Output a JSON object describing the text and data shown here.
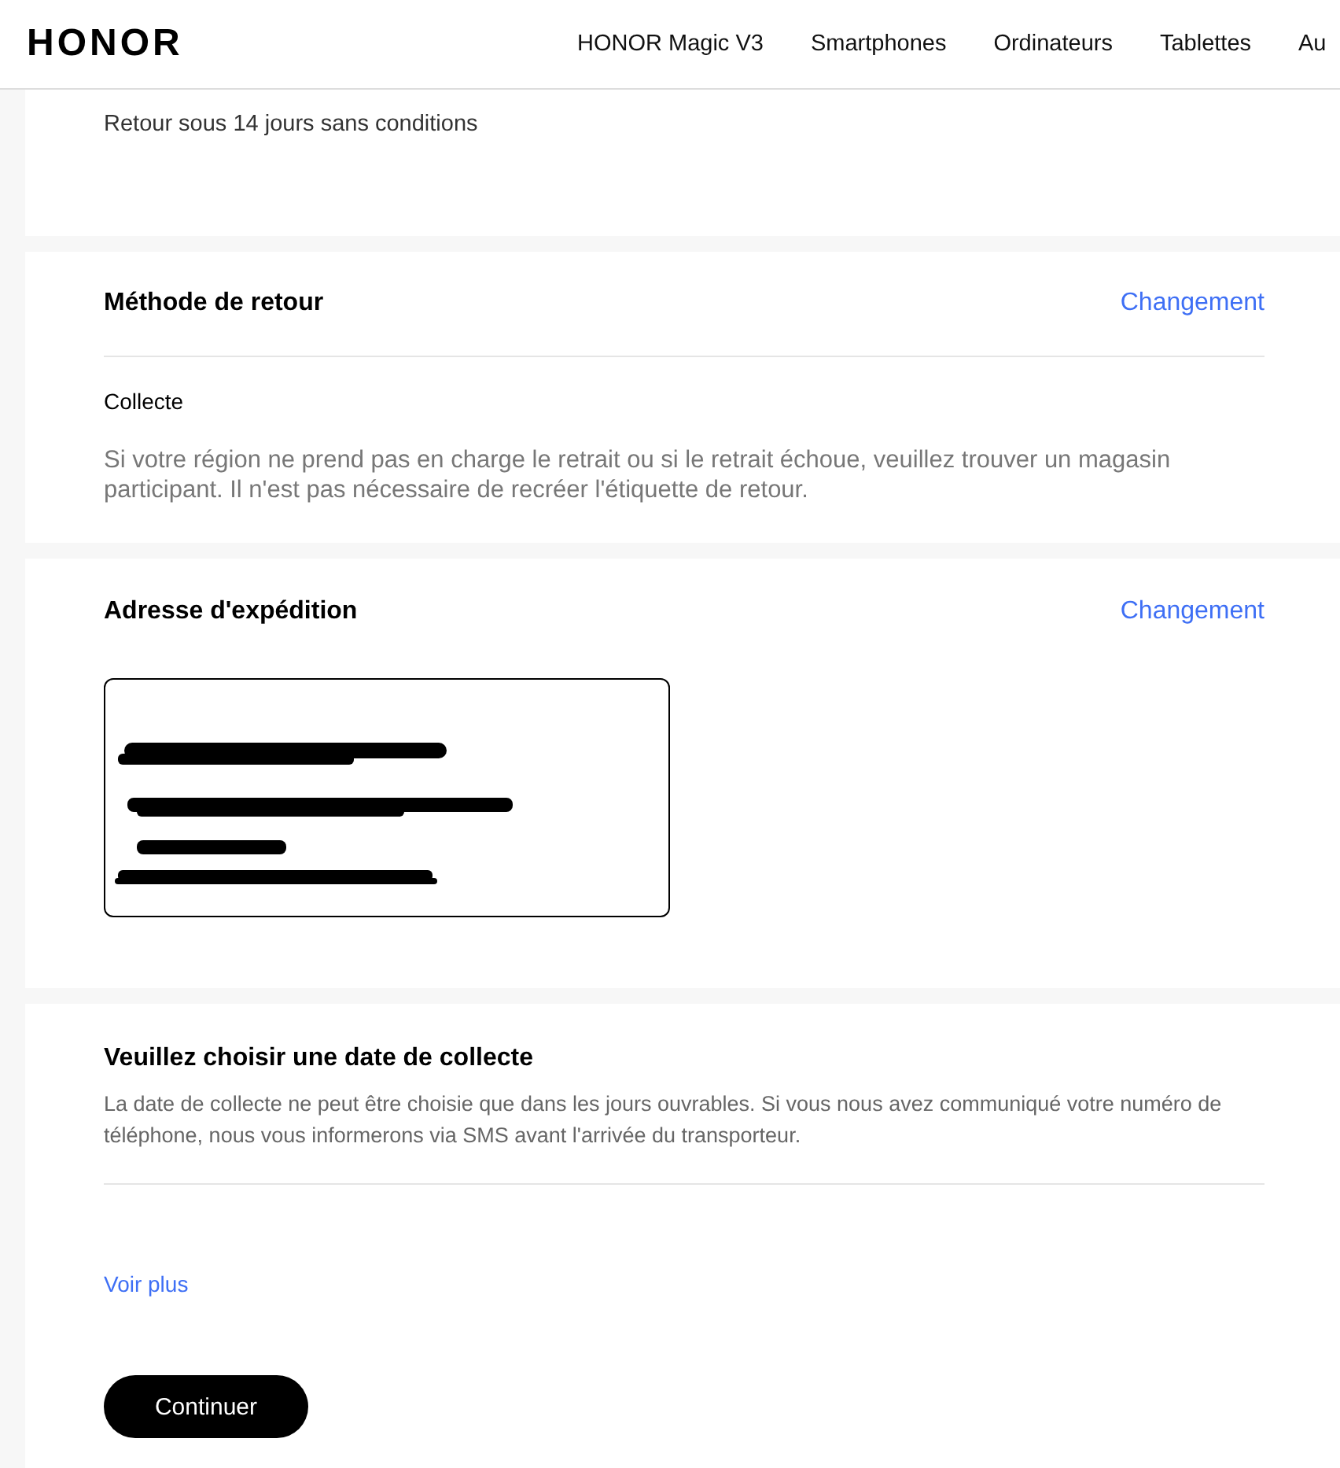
{
  "header": {
    "logo": "HONOR",
    "nav": [
      "HONOR Magic V3",
      "Smartphones",
      "Ordinateurs",
      "Tablettes",
      "Au"
    ]
  },
  "policy": {
    "text": "Retour sous 14 jours sans conditions"
  },
  "return_method": {
    "title": "Méthode de retour",
    "action": "Changement",
    "method": "Collecte",
    "note": "Si votre région ne prend pas en charge le retrait ou si le retrait échoue, veuillez trouver un magasin participant. Il n'est pas nécessaire de recréer l'étiquette de retour."
  },
  "shipping_address": {
    "title": "Adresse d'expédition",
    "action": "Changement"
  },
  "pickup_date": {
    "title": "Veuillez choisir une date de collecte",
    "description": "La date de collecte ne peut être choisie que dans les jours ouvrables. Si vous nous avez communiqué votre numéro de téléphone, nous vous informerons via SMS avant l'arrivée du transporteur.",
    "more_link": "Voir plus"
  },
  "continue_button": "Continuer"
}
